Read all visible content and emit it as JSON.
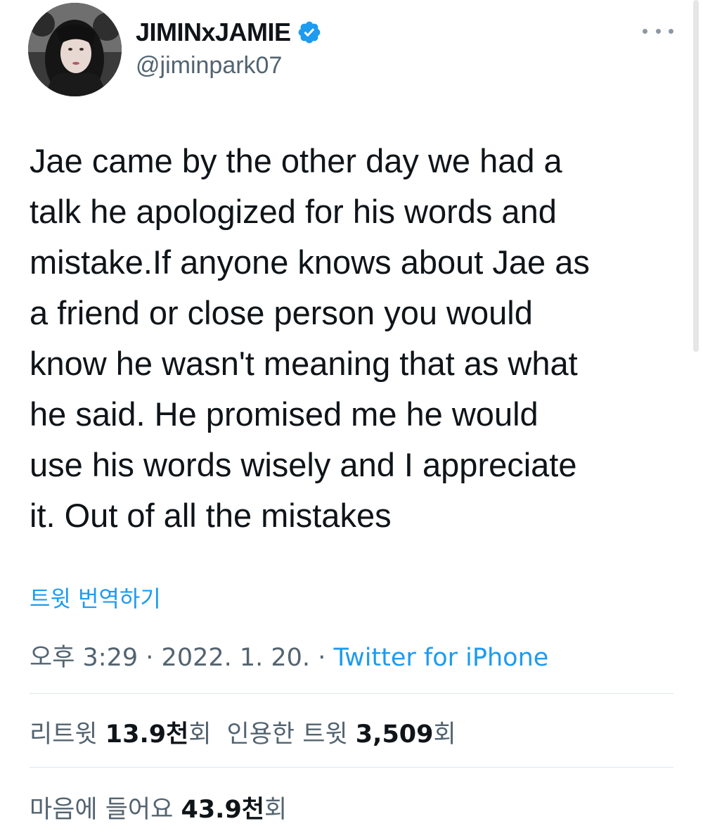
{
  "user": {
    "display_name": "JIMINxJAMIE",
    "handle": "@jiminpark07",
    "verified": true,
    "avatar_icon": "profile-photo"
  },
  "tweet": {
    "text": "Jae came by the other day we had a\ntalk he apologized for his words and\nmistake.If anyone knows about Jae as\na friend or close person you would\nknow he wasn't meaning that as what\nhe said. He promised me he would\nuse his words wisely and I appreciate\nit. Out of all the mistakes",
    "translate_label": "트윗 번역하기",
    "time": "오후 3:29",
    "separator": "·",
    "date": "2022. 1. 20.",
    "source": "Twitter for iPhone"
  },
  "stats": {
    "retweets_label": "리트윗",
    "retweets_value": "13.9천",
    "retweets_suffix": "회",
    "quotes_label": "인용한 트윗",
    "quotes_value": "3,509",
    "quotes_suffix": "회",
    "likes_label": "마음에 들어요",
    "likes_value": "43.9천",
    "likes_suffix": "회"
  },
  "colors": {
    "accent": "#1d9bf0",
    "text": "#0f1419",
    "secondary": "#536471",
    "divider": "#e1e6ea"
  },
  "icons": {
    "verified": "verified-badge-icon",
    "more": "more-options-icon"
  }
}
